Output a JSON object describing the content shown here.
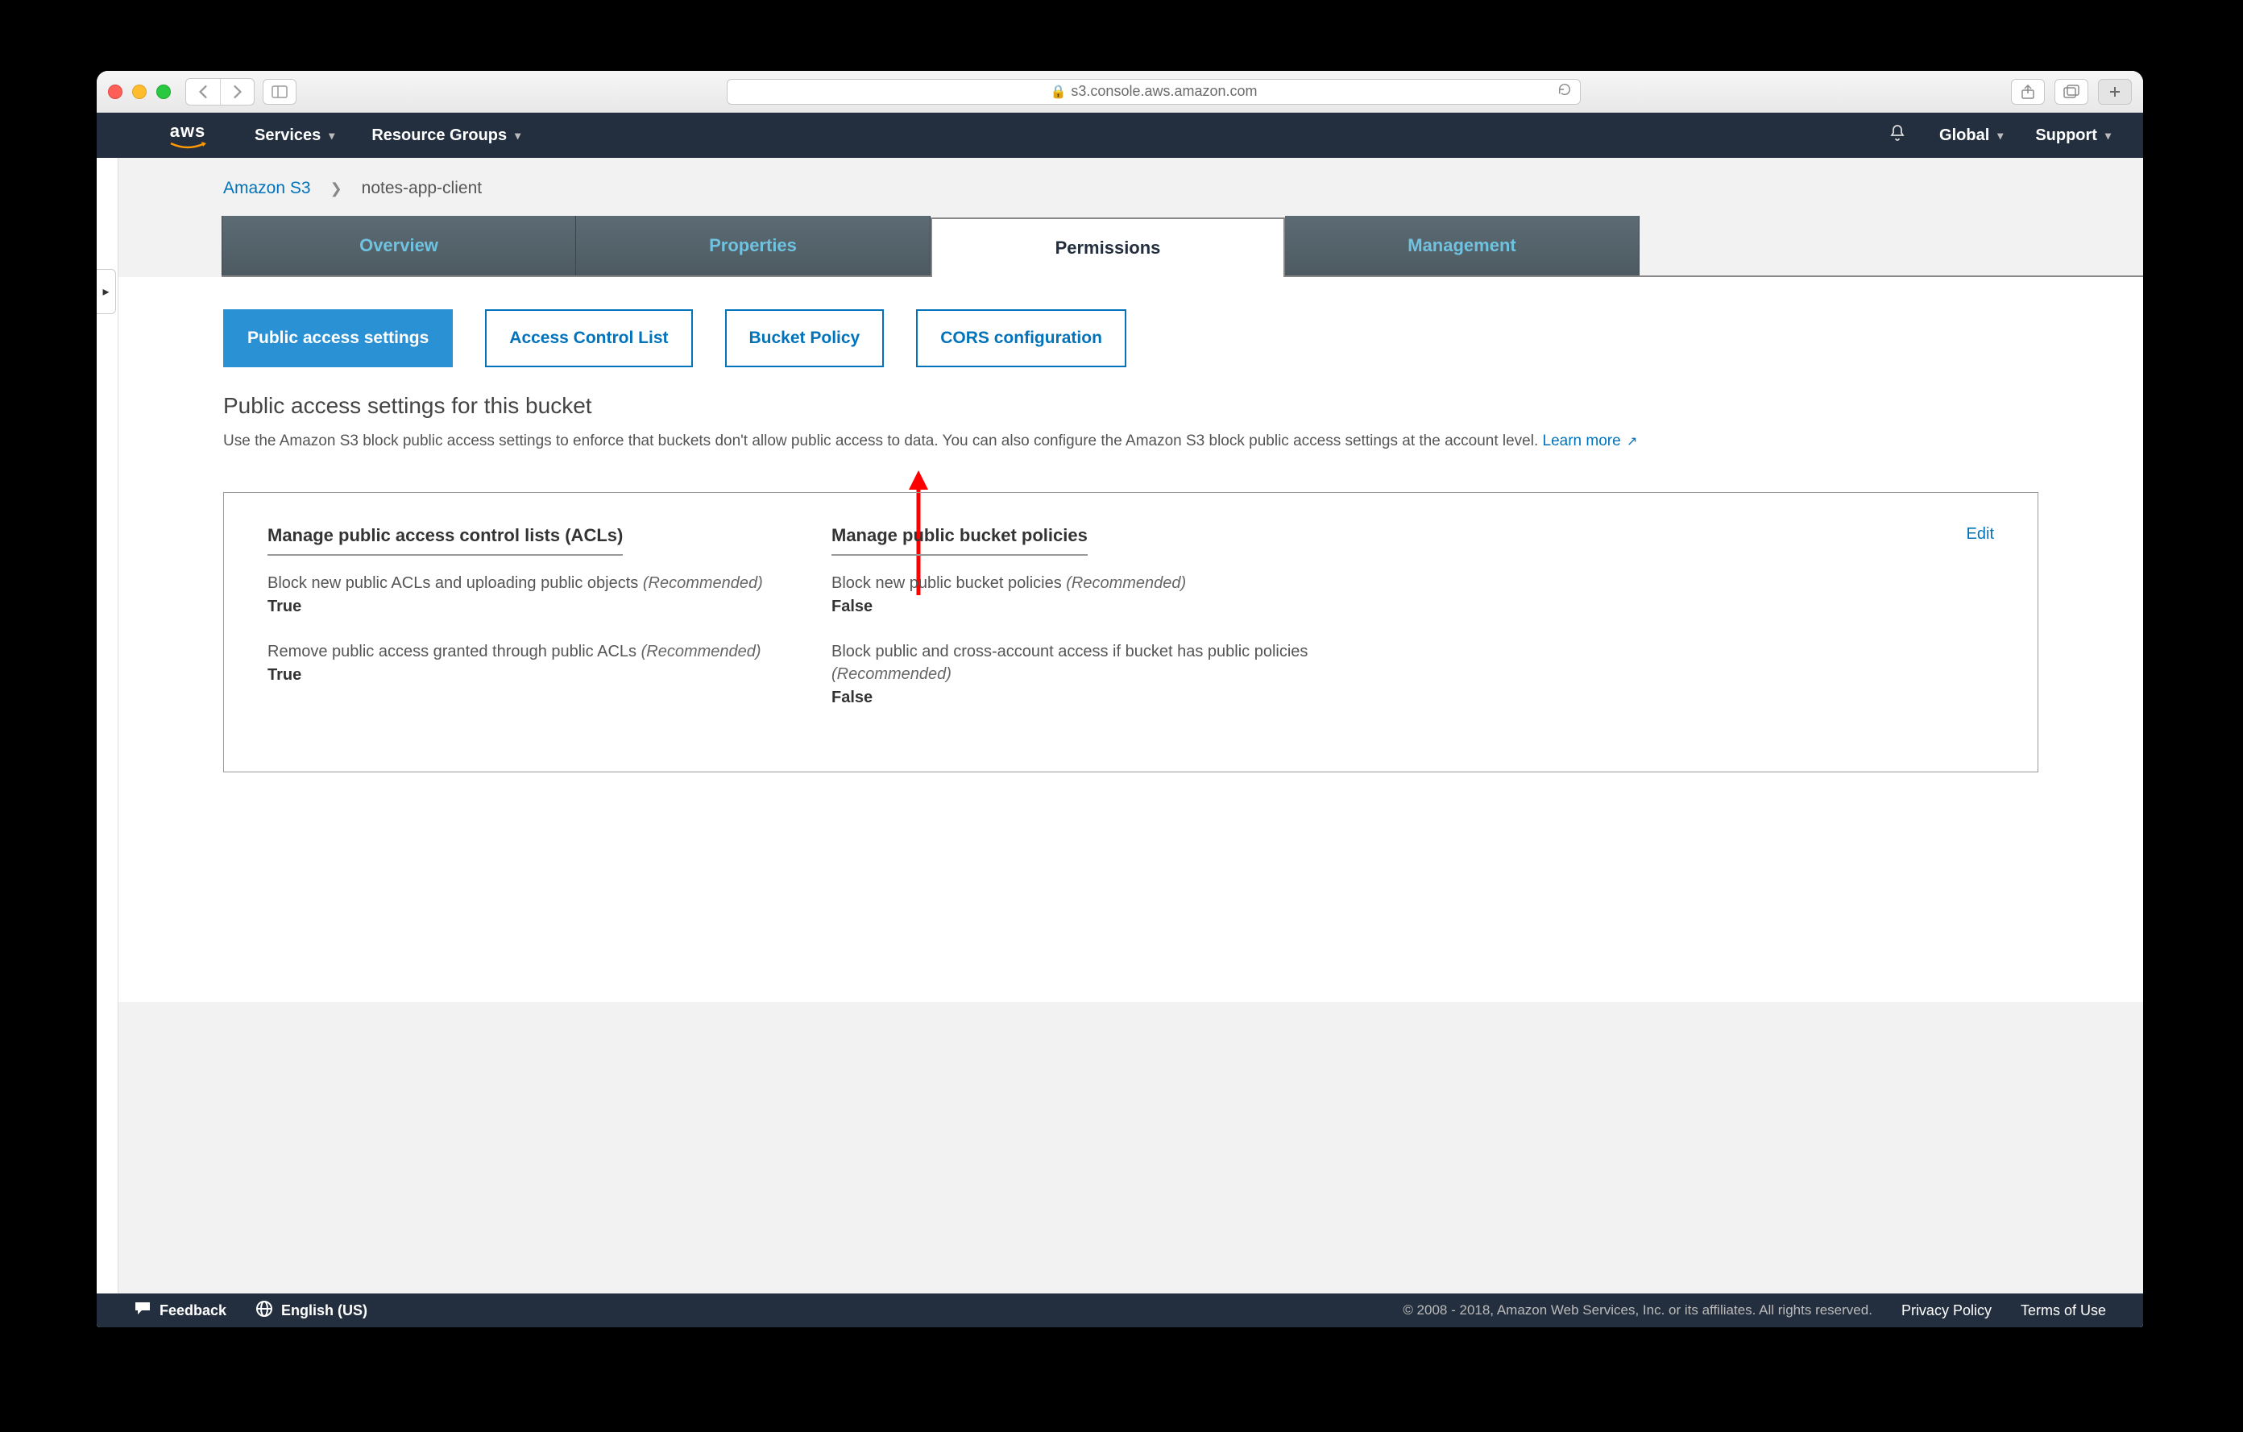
{
  "browser": {
    "url": "s3.console.aws.amazon.com"
  },
  "header": {
    "logo": "aws",
    "menu": {
      "services": "Services",
      "resource_groups": "Resource Groups"
    },
    "right": {
      "region": "Global",
      "support": "Support"
    }
  },
  "breadcrumb": {
    "root": "Amazon S3",
    "current": "notes-app-client"
  },
  "tabs": {
    "overview": "Overview",
    "properties": "Properties",
    "permissions": "Permissions",
    "management": "Management"
  },
  "subtabs": {
    "public_access": "Public access settings",
    "acl": "Access Control List",
    "bucket_policy": "Bucket Policy",
    "cors": "CORS configuration"
  },
  "section": {
    "title": "Public access settings for this bucket",
    "desc": "Use the Amazon S3 block public access settings to enforce that buckets don't allow public access to data. You can also configure the Amazon S3 block public access settings at the account level. ",
    "learn_more": "Learn more"
  },
  "box": {
    "edit": "Edit",
    "col1": {
      "heading": "Manage public access control lists (ACLs)",
      "item1": {
        "desc": "Block new public ACLs and uploading public objects ",
        "rec": "(Recommended)",
        "val": "True"
      },
      "item2": {
        "desc": "Remove public access granted through public ACLs ",
        "rec": "(Recommended)",
        "val": "True"
      }
    },
    "col2": {
      "heading": "Manage public bucket policies",
      "item1": {
        "desc": "Block new public bucket policies ",
        "rec": "(Recommended)",
        "val": "False"
      },
      "item2": {
        "desc": "Block public and cross-account access if bucket has public policies ",
        "rec": "(Recommended)",
        "val": "False"
      }
    }
  },
  "footer": {
    "feedback": "Feedback",
    "lang": "English (US)",
    "copy": "© 2008 - 2018, Amazon Web Services, Inc. or its affiliates. All rights reserved.",
    "privacy": "Privacy Policy",
    "terms": "Terms of Use"
  }
}
